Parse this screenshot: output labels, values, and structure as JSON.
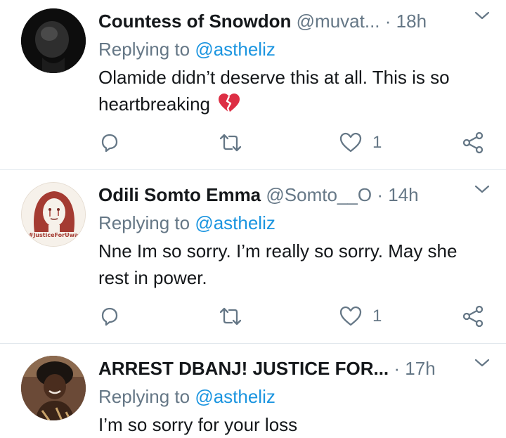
{
  "tweets": [
    {
      "name": "Countess of Snowdon",
      "handle": "@muvat...",
      "sep": "·",
      "time": "18h",
      "replying_prefix": "Replying to ",
      "replying_to": "@astheliz",
      "text": "Olamide didn’t deserve this at all. This is so heartbreaking",
      "emoji": "💔",
      "like_count": "1"
    },
    {
      "name": "Odili Somto Emma",
      "handle": "@Somto__O",
      "sep": "·",
      "time": "14h",
      "replying_prefix": "Replying to ",
      "replying_to": "@astheliz",
      "text": "Nne Im so sorry. I’m really so sorry. May she rest in power.",
      "like_count": "1",
      "avatar_caption": "#JusticeForUwa"
    },
    {
      "name": "ARREST DBANJ! JUSTICE FOR...",
      "handle": "",
      "sep": "·",
      "time": "17h",
      "replying_prefix": "Replying to ",
      "replying_to": "@astheliz",
      "text": "I’m so sorry for your loss"
    }
  ],
  "icons": {
    "reply": "reply-icon",
    "retweet": "retweet-icon",
    "like": "heart-icon",
    "share": "share-icon",
    "menu": "chevron-down-icon"
  },
  "colors": {
    "text": "#14171a",
    "secondary": "#657786",
    "mention": "#1b95e0",
    "divider": "#e1e8ed"
  }
}
